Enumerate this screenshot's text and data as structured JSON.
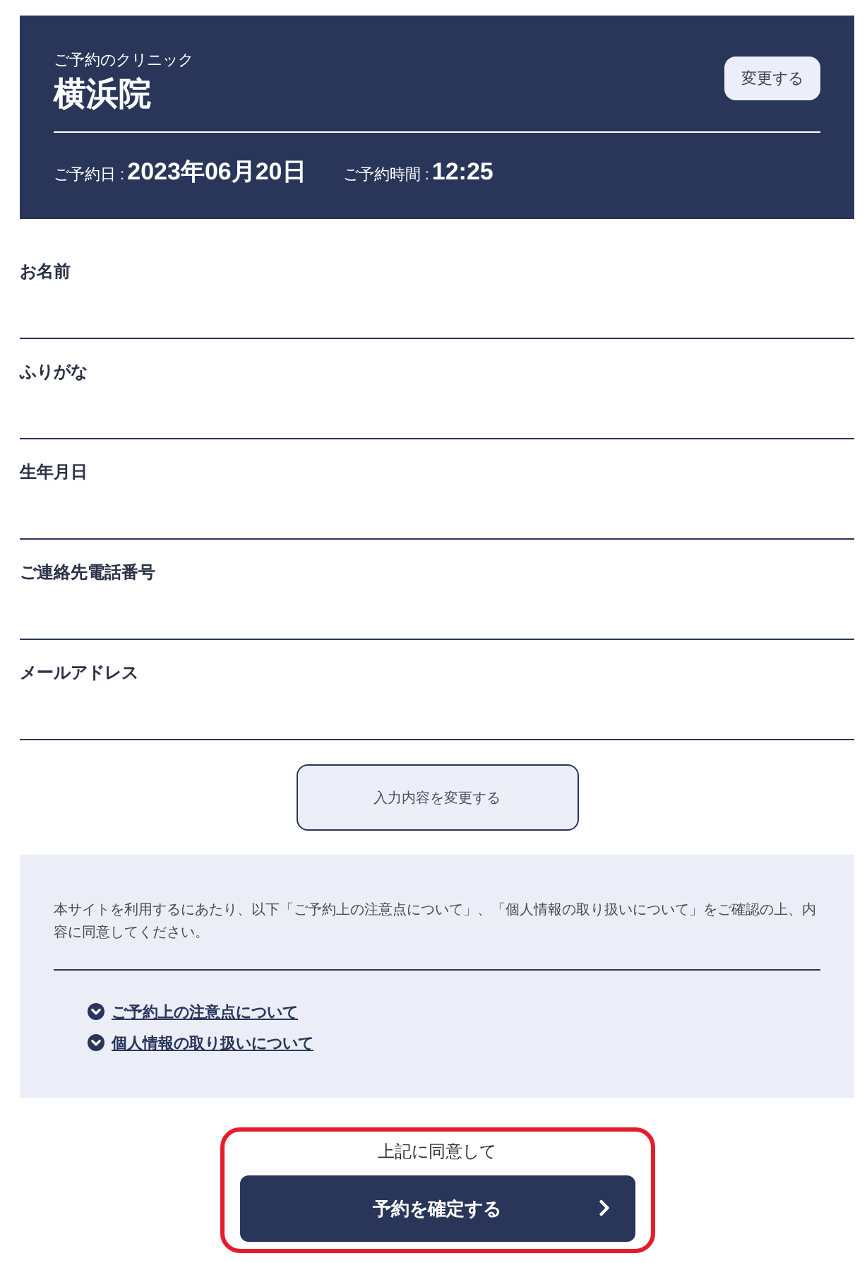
{
  "clinic": {
    "label": "ご予約のクリニック",
    "name": "横浜院",
    "change_button": "変更する",
    "date_label": "ご予約日 :",
    "date": "2023年06月20日",
    "time_label": "ご予約時間 :",
    "time": "12:25"
  },
  "form": {
    "fields": [
      {
        "label": "お名前"
      },
      {
        "label": "ふりがな"
      },
      {
        "label": "生年月日"
      },
      {
        "label": "ご連絡先電話番号"
      },
      {
        "label": "メールアドレス"
      }
    ],
    "edit_button": "入力内容を変更する"
  },
  "agreement": {
    "text": "本サイトを利用するにあたり、以下「ご予約上の注意点について」、「個人情報の取り扱いについて」をご確認の上、内容に同意してください。",
    "links": [
      "ご予約上の注意点について",
      "個人情報の取り扱いについて"
    ]
  },
  "confirm": {
    "note": "上記に同意して",
    "button": "予約を確定する",
    "highlighted": true
  }
}
